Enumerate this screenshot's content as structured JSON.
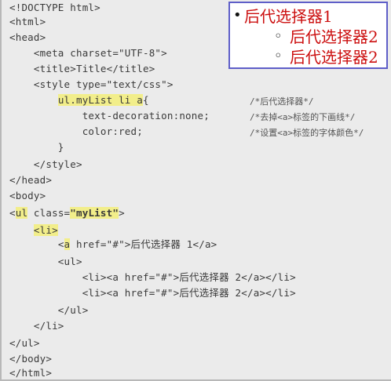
{
  "code_lines": [
    "<!DOCTYPE html>",
    "<html>",
    "<head>",
    "    <meta charset=\"UTF-8\">",
    "    <title>Title</title>",
    "    <style type=\"text/css\">",
    "        ",
    "            text-decoration:none;",
    "            color:red;",
    "        }",
    "    </style>",
    "</head>",
    "<body>",
    "",
    "    ",
    "        ",
    "        <ul>",
    "            <li><a href=\"#\">后代选择器 2</a></li>",
    "            <li><a href=\"#\">后代选择器 2</a></li>",
    "        </ul>",
    "    </li>",
    "</ul>",
    "</body>",
    "</html>"
  ],
  "highlights": {
    "selector": "ul.myList li a",
    "selector_tail": "{",
    "ul_tag": "ul",
    "class_attr": " class=",
    "class_value": "\"myList\"",
    "ul_close": ">",
    "li_tag": "li",
    "li_open": "<",
    "li_close": ">",
    "a_open": "<",
    "a_tag": "a",
    "a_rest": " href=\"#\">后代选择器 1</a>",
    "ul_open": "<"
  },
  "comments": [
    "/*后代选择器*/",
    "/*去掉<a>标签的下画线*/",
    "/*设置<a>标签的字体颜色*/"
  ],
  "preview": {
    "item1": "后代选择器1",
    "item2": "后代选择器2",
    "item3": "后代选择器2",
    "bullet_disc": "•",
    "bullet_circle": "◦"
  }
}
